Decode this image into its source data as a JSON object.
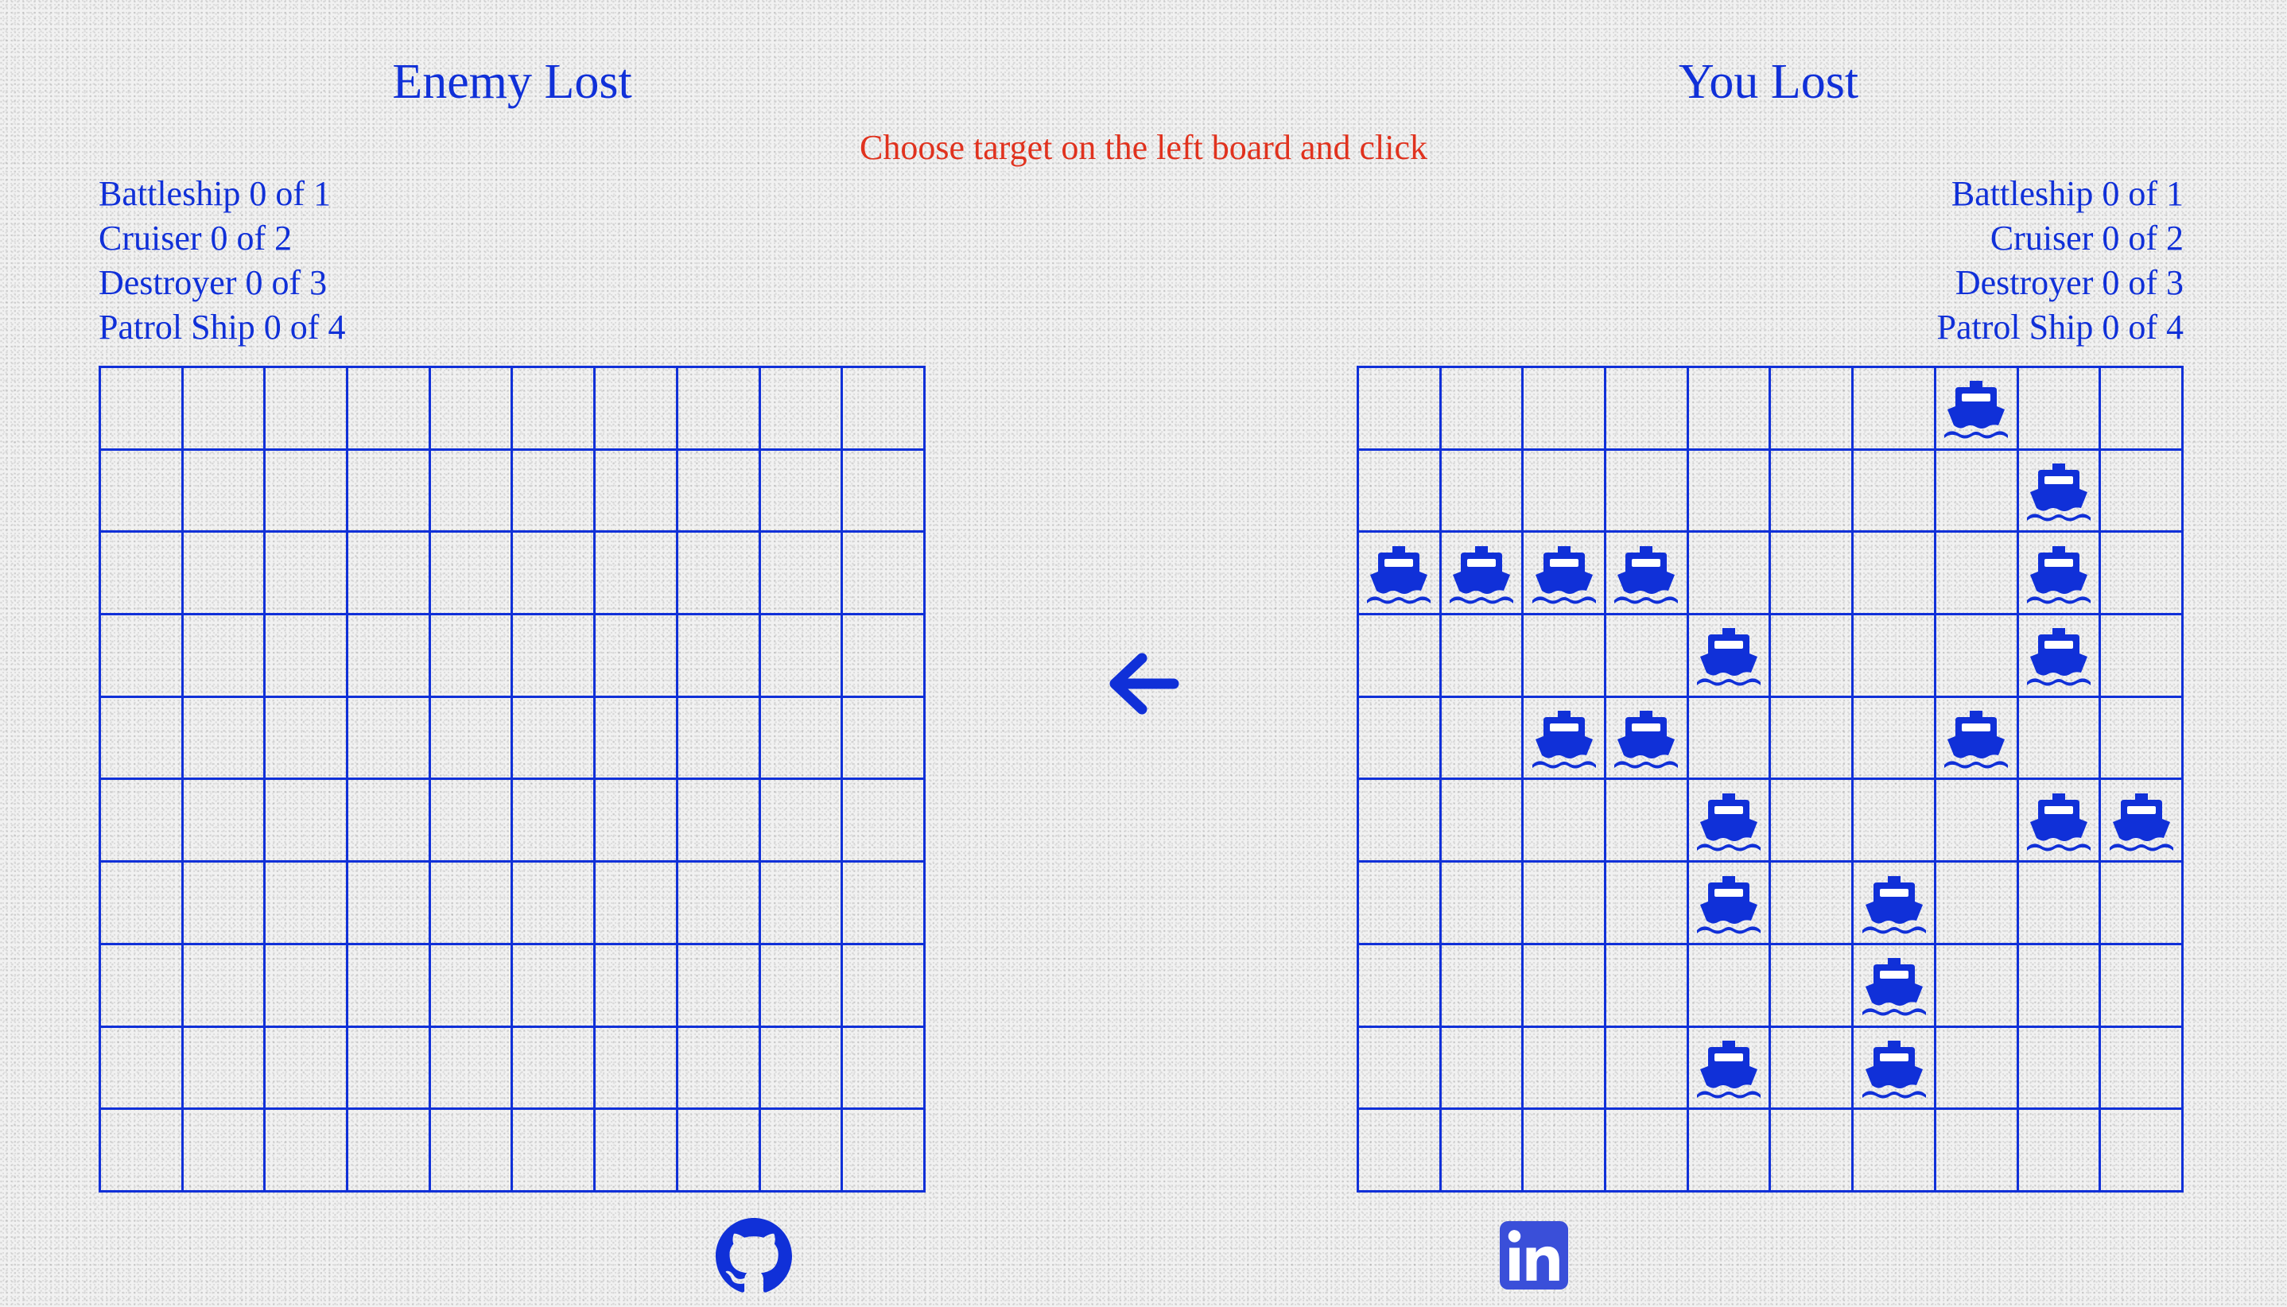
{
  "game": {
    "status_message": "Choose target on the left board and click",
    "turn_indicator_icon": "arrow-left-icon",
    "board_size": 10
  },
  "colors": {
    "primary": "#1030d8",
    "status": "#e0321e",
    "linkedin": "#3a4fd9"
  },
  "enemy": {
    "title": "Enemy Lost",
    "fleet": [
      {
        "label": "Battleship 0 of 1"
      },
      {
        "label": "Cruiser 0 of 2"
      },
      {
        "label": "Destroyer 0 of 3"
      },
      {
        "label": "Patrol Ship 0 of 4"
      }
    ],
    "ships": []
  },
  "player": {
    "title": "You Lost",
    "fleet": [
      {
        "label": "Battleship 0 of 1"
      },
      {
        "label": "Cruiser 0 of 2"
      },
      {
        "label": "Destroyer 0 of 3"
      },
      {
        "label": "Patrol Ship 0 of 4"
      }
    ],
    "ship_icon": "ship-icon",
    "ships": [
      {
        "row": 0,
        "col": 7
      },
      {
        "row": 1,
        "col": 8
      },
      {
        "row": 2,
        "col": 0
      },
      {
        "row": 2,
        "col": 1
      },
      {
        "row": 2,
        "col": 2
      },
      {
        "row": 2,
        "col": 3
      },
      {
        "row": 2,
        "col": 8
      },
      {
        "row": 3,
        "col": 4
      },
      {
        "row": 3,
        "col": 8
      },
      {
        "row": 4,
        "col": 2
      },
      {
        "row": 4,
        "col": 3
      },
      {
        "row": 4,
        "col": 7
      },
      {
        "row": 5,
        "col": 4
      },
      {
        "row": 5,
        "col": 8
      },
      {
        "row": 5,
        "col": 9
      },
      {
        "row": 6,
        "col": 4
      },
      {
        "row": 6,
        "col": 6
      },
      {
        "row": 7,
        "col": 6
      },
      {
        "row": 8,
        "col": 4
      },
      {
        "row": 8,
        "col": 6
      }
    ]
  },
  "footer": {
    "links": [
      {
        "name": "github",
        "icon": "github-icon"
      },
      {
        "name": "linkedin",
        "icon": "linkedin-icon"
      }
    ]
  }
}
